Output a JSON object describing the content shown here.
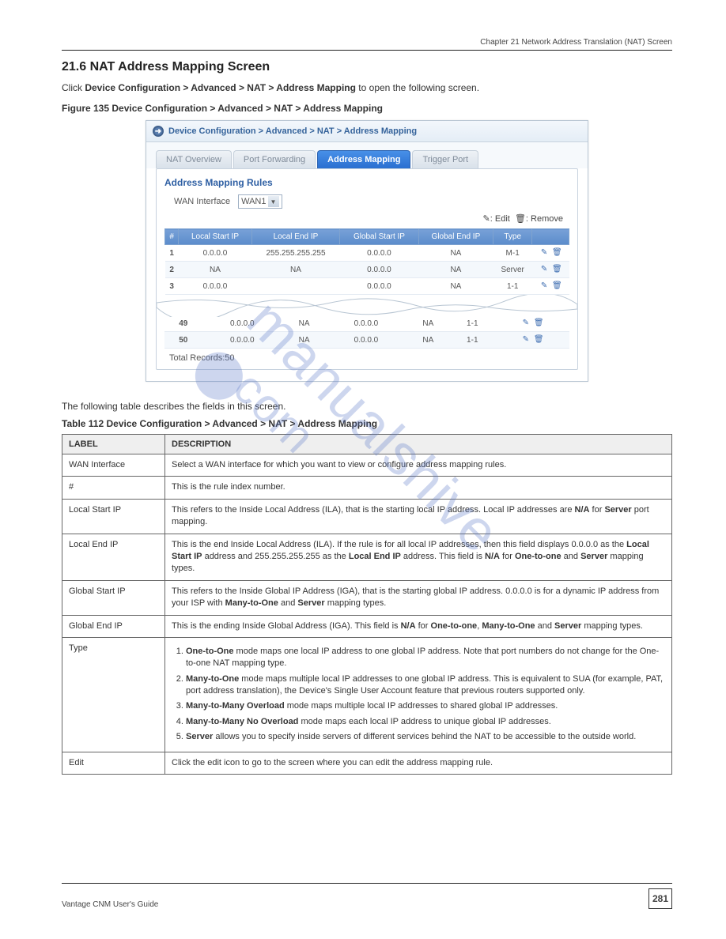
{
  "header": {
    "right": " Chapter 21 Network Address Translation (NAT) Screen"
  },
  "section": {
    "number": "21.6",
    "title": "NAT Address Mapping Screen",
    "desc_pre": "Click ",
    "desc_path": "Device Configuration > Advanced > NAT > Address Mapping",
    "desc_post": " to open the following screen."
  },
  "figure": {
    "label": "Figure 135   ",
    "caption": "Device Configuration > Advanced > NAT > Address Mapping"
  },
  "screenshot": {
    "breadcrumb": "Device Configuration > Advanced > NAT > Address Mapping",
    "tabs": [
      "NAT Overview",
      "Port Forwarding",
      "Address Mapping",
      "Trigger Port"
    ],
    "active_tab": 2,
    "panel_title": "Address Mapping Rules",
    "wan_label": "WAN Interface",
    "wan_value": "WAN1",
    "legend_edit": ": Edit",
    "legend_remove": ": Remove",
    "columns": [
      "#",
      "Local Start IP",
      "Local End IP",
      "Global Start IP",
      "Global End IP",
      "Type",
      ""
    ],
    "rows_top": [
      {
        "n": "1",
        "ls": "0.0.0.0",
        "le": "255.255.255.255",
        "gs": "0.0.0.0",
        "ge": "NA",
        "t": "M-1"
      },
      {
        "n": "2",
        "ls": "NA",
        "le": "NA",
        "gs": "0.0.0.0",
        "ge": "NA",
        "t": "Server"
      },
      {
        "n": "3",
        "ls": "0.0.0.0",
        "le": "",
        "gs": "0.0.0.0",
        "ge": "NA",
        "t": "1-1"
      }
    ],
    "rows_bottom": [
      {
        "n": "49",
        "ls": "0.0.0.0",
        "le": "NA",
        "gs": "0.0.0.0",
        "ge": "NA",
        "t": "1-1"
      },
      {
        "n": "50",
        "ls": "0.0.0.0",
        "le": "NA",
        "gs": "0.0.0.0",
        "ge": "NA",
        "t": "1-1"
      }
    ],
    "total": "Total Records:50"
  },
  "desc_table_intro": "The following table describes the fields in this screen.",
  "table_caption": {
    "label": "Table 112   ",
    "caption": "Device Configuration > Advanced > NAT > Address Mapping"
  },
  "info_table": {
    "h1": "LABEL",
    "h2": "DESCRIPTION",
    "rows": [
      {
        "l": "WAN Interface",
        "d": "Select a WAN interface for which you want to view or configure address mapping rules."
      },
      {
        "l": "#",
        "d": "This is the rule index number."
      },
      {
        "l": "Local Start IP",
        "d": "This refers to the Inside Local Address (ILA), that is the starting local IP address. Local IP addresses are <b>N/A</b> for <b>Server</b> port mapping."
      },
      {
        "l": "Local End IP",
        "d": "This is the end Inside Local Address (ILA). If the rule is for all local IP addresses, then this field displays 0.0.0.0 as the <b>Local Start IP</b> address and 255.255.255.255 as the <b>Local End IP</b> address. This field is <b>N/A</b> for <b>One-to-one</b> and <b>Server</b> mapping types."
      },
      {
        "l": "Global Start IP",
        "d": "This refers to the Inside Global IP Address (IGA), that is the starting global IP address. 0.0.0.0 is for a dynamic IP address from your ISP with <b>Many-to-One</b> and <b>Server</b> mapping types."
      },
      {
        "l": "Global End IP",
        "d": "This is the ending Inside Global Address (IGA). This field is <b>N/A</b> for <b>One-to-one</b>, <b>Many-to-One</b> and <b>Server</b> mapping types."
      },
      {
        "l": "Type",
        "d": "<ol><li><b>One-to-One</b> mode maps one local IP address to one global IP address. Note that port numbers do not change for the One-to-one NAT mapping type.</li><li><b>Many-to-One</b> mode maps multiple local IP addresses to one global IP address. This is equivalent to SUA (for example, PAT, port address translation), the Device's Single User Account feature that previous routers supported only.</li><li><b>Many-to-Many Overload</b> mode maps multiple local IP addresses to shared global IP addresses.</li><li><b>Many-to-Many No Overload</b> mode maps each local IP address to unique global IP addresses.</li><li><b>Server</b> allows you to specify inside servers of different services behind the NAT to be accessible to the outside world.</li></ol>"
      },
      {
        "l": "Edit",
        "d": "Click the edit icon to go to the screen where you can edit the address mapping rule."
      }
    ]
  },
  "footer": {
    "guide": "Vantage CNM User's Guide",
    "page": "281"
  },
  "watermark": "manualshive.com"
}
